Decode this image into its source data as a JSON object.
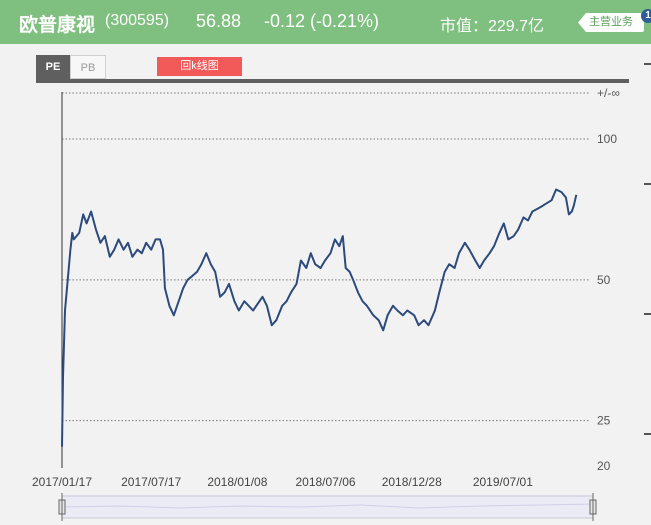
{
  "header": {
    "stock_name": "欧普康视",
    "stock_code": "(300595)",
    "price": "56.88",
    "change": "-0.12 (-0.21%)",
    "market_cap": "市值：229.7亿",
    "main_business_button": "主营业务",
    "badge": "1"
  },
  "tabs": [
    {
      "label": "PE",
      "active": true
    },
    {
      "label": "PB",
      "active": false
    }
  ],
  "kline_button": "回k线图",
  "colors": {
    "header_bg": "#7fbf7f",
    "line": "#2c4a7c",
    "kline_button": "#f25a5a",
    "tab_active": "#5f5f5f"
  },
  "chart_data": {
    "type": "line",
    "metric": "PE",
    "y_scale": "log",
    "y_ticks": [
      "+/-∞",
      "100",
      "50",
      "25",
      "20"
    ],
    "y_tick_values": [
      null,
      100,
      50,
      25,
      20
    ],
    "x_ticks": [
      "2017/01/17",
      "2017/07/17",
      "2018/01/08",
      "2018/07/06",
      "2018/12/28",
      "2019/07/01"
    ],
    "grid": "dotted horizontal",
    "series": [
      {
        "color": "#2c4a7c",
        "points": [
          [
            "2017/01/17",
            22.0
          ],
          [
            "2017/01/19",
            31.0
          ],
          [
            "2017/01/23",
            43.0
          ],
          [
            "2017/02/03",
            58.0
          ],
          [
            "2017/02/07",
            63.0
          ],
          [
            "2017/02/10",
            61.0
          ],
          [
            "2017/02/21",
            63.0
          ],
          [
            "2017/03/01",
            69.0
          ],
          [
            "2017/03/08",
            66.0
          ],
          [
            "2017/03/17",
            70.0
          ],
          [
            "2017/03/27",
            64.0
          ],
          [
            "2017/04/05",
            60.0
          ],
          [
            "2017/04/14",
            62.0
          ],
          [
            "2017/04/24",
            56.0
          ],
          [
            "2017/05/03",
            58.0
          ],
          [
            "2017/05/12",
            61.0
          ],
          [
            "2017/05/22",
            58.0
          ],
          [
            "2017/05/31",
            60.0
          ],
          [
            "2017/06/09",
            56.0
          ],
          [
            "2017/06/19",
            58.0
          ],
          [
            "2017/06/28",
            57.0
          ],
          [
            "2017/07/07",
            60.0
          ],
          [
            "2017/07/17",
            58.0
          ],
          [
            "2017/07/26",
            61.0
          ],
          [
            "2017/08/04",
            61.0
          ],
          [
            "2017/08/10",
            58.0
          ],
          [
            "2017/08/14",
            48.0
          ],
          [
            "2017/08/23",
            44.0
          ],
          [
            "2017/09/01",
            42.0
          ],
          [
            "2017/09/11",
            45.0
          ],
          [
            "2017/09/20",
            48.0
          ],
          [
            "2017/09/29",
            50.0
          ],
          [
            "2017/10/09",
            51.0
          ],
          [
            "2017/10/18",
            52.0
          ],
          [
            "2017/10/27",
            54.0
          ],
          [
            "2017/11/06",
            57.0
          ],
          [
            "2017/11/15",
            54.0
          ],
          [
            "2017/11/24",
            52.0
          ],
          [
            "2017/12/04",
            46.0
          ],
          [
            "2017/12/13",
            47.0
          ],
          [
            "2017/12/22",
            49.0
          ],
          [
            "2018/01/02",
            45.0
          ],
          [
            "2018/01/11",
            43.0
          ],
          [
            "2018/01/22",
            45.0
          ],
          [
            "2018/01/31",
            44.0
          ],
          [
            "2018/02/09",
            43.0
          ],
          [
            "2018/02/28",
            46.0
          ],
          [
            "2018/03/09",
            44.0
          ],
          [
            "2018/03/19",
            40.0
          ],
          [
            "2018/03/28",
            41.0
          ],
          [
            "2018/04/09",
            44.0
          ],
          [
            "2018/04/18",
            45.0
          ],
          [
            "2018/04/27",
            47.0
          ],
          [
            "2018/05/08",
            49.0
          ],
          [
            "2018/05/17",
            55.0
          ],
          [
            "2018/05/28",
            53.0
          ],
          [
            "2018/06/06",
            57.0
          ],
          [
            "2018/06/15",
            54.0
          ],
          [
            "2018/06/26",
            53.0
          ],
          [
            "2018/07/05",
            55.0
          ],
          [
            "2018/07/16",
            57.0
          ],
          [
            "2018/07/25",
            61.0
          ],
          [
            "2018/08/03",
            59.0
          ],
          [
            "2018/08/10",
            62.0
          ],
          [
            "2018/08/16",
            53.0
          ],
          [
            "2018/08/24",
            52.0
          ],
          [
            "2018/08/31",
            50.0
          ],
          [
            "2018/09/10",
            47.0
          ],
          [
            "2018/09/19",
            45.0
          ],
          [
            "2018/09/28",
            44.0
          ],
          [
            "2018/10/11",
            42.0
          ],
          [
            "2018/10/22",
            41.0
          ],
          [
            "2018/10/31",
            39.0
          ],
          [
            "2018/11/09",
            42.0
          ],
          [
            "2018/11/20",
            44.0
          ],
          [
            "2018/11/29",
            43.0
          ],
          [
            "2018/12/10",
            42.0
          ],
          [
            "2018/12/19",
            43.0
          ],
          [
            "2019/01/02",
            42.0
          ],
          [
            "2019/01/11",
            40.0
          ],
          [
            "2019/01/22",
            41.0
          ],
          [
            "2019/01/31",
            40.0
          ],
          [
            "2019/02/13",
            43.0
          ],
          [
            "2019/02/22",
            47.0
          ],
          [
            "2019/03/05",
            52.0
          ],
          [
            "2019/03/14",
            54.0
          ],
          [
            "2019/03/25",
            53.0
          ],
          [
            "2019/04/03",
            57.0
          ],
          [
            "2019/04/15",
            60.0
          ],
          [
            "2019/04/24",
            58.0
          ],
          [
            "2019/05/06",
            55.0
          ],
          [
            "2019/05/15",
            53.0
          ],
          [
            "2019/05/24",
            55.0
          ],
          [
            "2019/06/04",
            57.0
          ],
          [
            "2019/06/13",
            59.0
          ],
          [
            "2019/06/24",
            63.0
          ],
          [
            "2019/07/03",
            66.0
          ],
          [
            "2019/07/12",
            61.0
          ],
          [
            "2019/07/23",
            62.0
          ],
          [
            "2019/08/01",
            64.0
          ],
          [
            "2019/08/12",
            68.0
          ],
          [
            "2019/08/21",
            67.0
          ],
          [
            "2019/08/30",
            70.0
          ],
          [
            "2019/09/10",
            71.0
          ],
          [
            "2019/09/20",
            72.0
          ],
          [
            "2019/10/08",
            74.0
          ],
          [
            "2019/10/17",
            78.0
          ],
          [
            "2019/10/28",
            77.0
          ],
          [
            "2019/11/06",
            75.0
          ],
          [
            "2019/11/12",
            69.0
          ],
          [
            "2019/11/18",
            70.0
          ],
          [
            "2019/11/22",
            72.0
          ],
          [
            "2019/11/27",
            76.0
          ]
        ]
      }
    ]
  }
}
